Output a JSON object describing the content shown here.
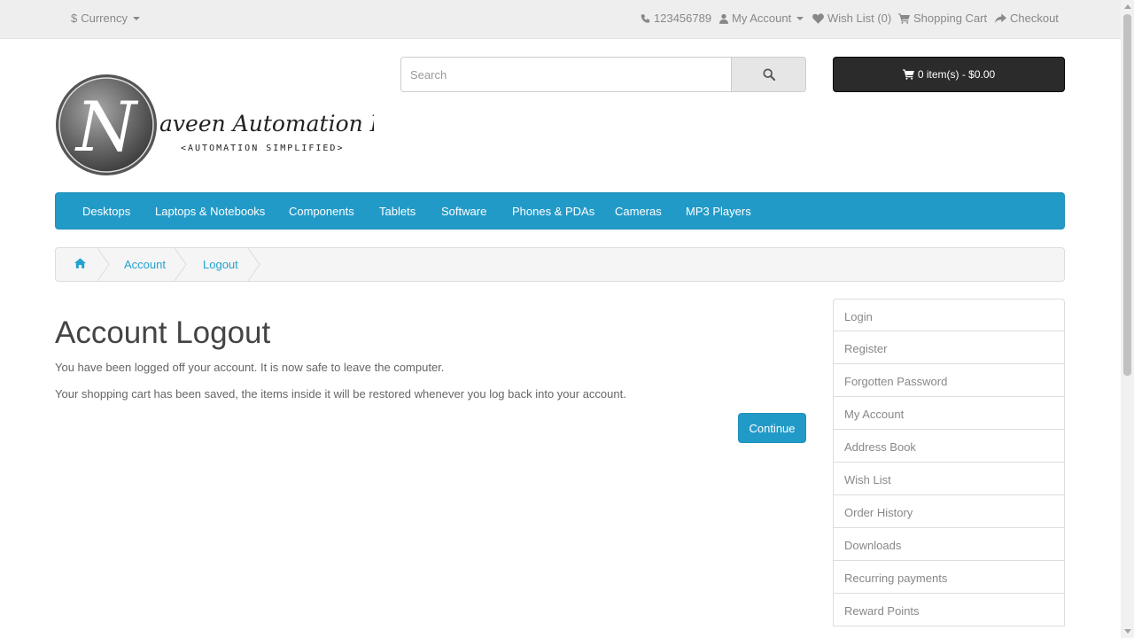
{
  "topbar": {
    "currency": {
      "symbol": "$",
      "label": "Currency"
    },
    "phone": "123456789",
    "my_account": "My Account",
    "wishlist": "Wish List (0)",
    "shopping_cart": "Shopping Cart",
    "checkout": "Checkout"
  },
  "logo": {
    "letter": "N",
    "name": "aveen Automation Labs",
    "tagline": "<AUTOMATION SIMPLIFIED>"
  },
  "search": {
    "placeholder": "Search",
    "icon": "search-icon"
  },
  "cart": {
    "label": "0 item(s) - $0.00",
    "icon": "cart-icon"
  },
  "menu": {
    "items": [
      "Desktops",
      "Laptops & Notebooks",
      "Components",
      "Tablets",
      "Software",
      "Phones & PDAs",
      "Cameras",
      "MP3 Players"
    ]
  },
  "breadcrumb": {
    "home_icon": "home-icon",
    "items": [
      "Account",
      "Logout"
    ]
  },
  "main": {
    "title": "Account Logout",
    "paragraphs": [
      "You have been logged off your account. It is now safe to leave the computer.",
      "Your shopping cart has been saved, the items inside it will be restored whenever you log back into your account."
    ],
    "continue_label": "Continue"
  },
  "account_list": {
    "items": [
      "Login",
      "Register",
      "Forgotten Password",
      "My Account",
      "Address Book",
      "Wish List",
      "Order History",
      "Downloads",
      "Recurring payments",
      "Reward Points"
    ]
  },
  "colors": {
    "menu_bg": "#229ac8",
    "link": "#23a1d1",
    "cart_bg": "#2b2b2b",
    "topbar_bg": "#eeeeee"
  }
}
